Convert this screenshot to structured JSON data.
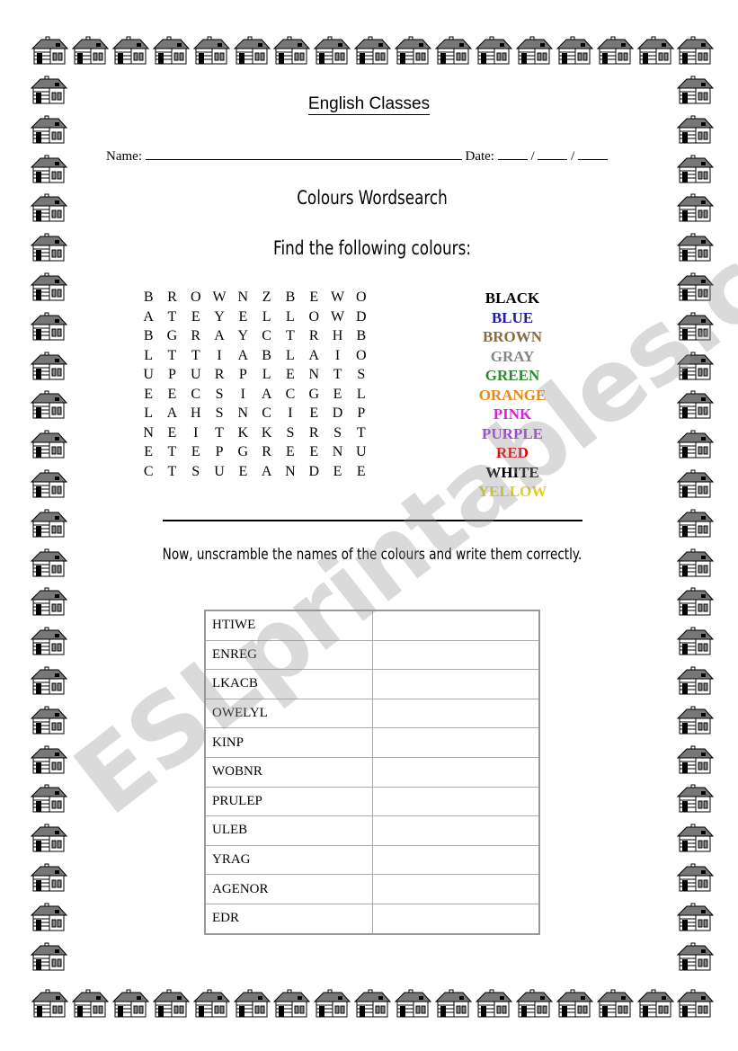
{
  "header": {
    "title": "English Classes",
    "name_label": "Name:",
    "date_label": "Date:",
    "date_sep": "/"
  },
  "wordsearch": {
    "title": "Colours Wordsearch",
    "instruction": "Find the following colours:",
    "grid": [
      "BROWNZBEWO",
      "ATEYELLOWD",
      "BGRAYCTRHB",
      "LTTIABLAIO",
      "UPURPLENTS",
      "EECSIACGEL",
      "LAHSNCIEDP",
      "NEITKKSRST",
      "ETEPGREENU",
      "CTSUEANDEE"
    ],
    "words": [
      {
        "text": "BLACK",
        "color": "#000000"
      },
      {
        "text": "BLUE",
        "color": "#1c1ca8"
      },
      {
        "text": "BROWN",
        "color": "#8a6d40"
      },
      {
        "text": "GRAY",
        "color": "#858585"
      },
      {
        "text": "GREEN",
        "color": "#2e8a2e"
      },
      {
        "text": "ORANGE",
        "color": "#e08a20"
      },
      {
        "text": "PINK",
        "color": "#e020e0"
      },
      {
        "text": "PURPLE",
        "color": "#a040d0"
      },
      {
        "text": "RED",
        "color": "#e00000"
      },
      {
        "text": "WHITE",
        "color": "#000000"
      },
      {
        "text": "YELLOW",
        "color": "#e0d020"
      }
    ]
  },
  "unscramble": {
    "instruction": "Now, unscramble the names of the colours and write them correctly.",
    "rows": [
      "HTIWE",
      "ENREG",
      "LKACB",
      "OWELYL",
      "KINP",
      "WOBNR",
      "PRULEP",
      "ULEB",
      "YRAG",
      "AGENOR",
      "EDR"
    ]
  },
  "watermark": "ESLprintables.com",
  "border_icon": "house-icon"
}
